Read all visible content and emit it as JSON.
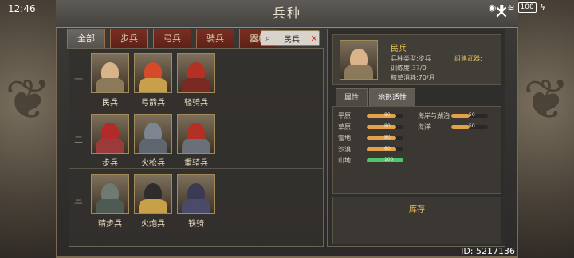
{
  "status_bar": {
    "time": "12:46",
    "battery": "100"
  },
  "window": {
    "title": "兵种",
    "close_icon": "close-x-icon"
  },
  "filter_tabs": [
    "全部",
    "步兵",
    "弓兵",
    "骑兵",
    "器械"
  ],
  "search": {
    "value": "民兵"
  },
  "units": [
    {
      "row": "一",
      "items": [
        {
          "name": "民兵",
          "helmet": "#c9c4b8",
          "armor": "#8a7a5a"
        },
        {
          "name": "弓箭兵",
          "helmet": "#d64a2a",
          "armor": "#c9a04a"
        },
        {
          "name": "轻骑兵",
          "helmet": "#b53024",
          "armor": "#7a2a22"
        }
      ]
    },
    {
      "row": "二",
      "items": [
        {
          "name": "步兵",
          "helmet": "#b22a2a",
          "armor": "#9a3a3a"
        },
        {
          "name": "火枪兵",
          "helmet": "#7c8590",
          "armor": "#5f6670"
        },
        {
          "name": "重骑兵",
          "helmet": "#b53024",
          "armor": "#6a6f78"
        }
      ]
    },
    {
      "row": "三",
      "items": [
        {
          "name": "精步兵",
          "helmet": "#6f7a72",
          "armor": "#4f5a52"
        },
        {
          "name": "火炮兵",
          "helmet": "#2f2d2b",
          "armor": "#c9a04a"
        },
        {
          "name": "铁骑",
          "helmet": "#3a3a55",
          "armor": "#4a4a6a"
        }
      ]
    }
  ],
  "detail": {
    "name": "民兵",
    "type_label": "兵种类型:",
    "type_value": "步兵",
    "train_label": "训练度:",
    "train_value": "37",
    "train_suffix": "/0",
    "food_label": "粮草消耗:",
    "food_value": "70/月",
    "craft_link": "组建武器:",
    "tabs": [
      "属性",
      "地形适性"
    ],
    "active_tab": 1,
    "terrain": [
      {
        "name": "平原",
        "value": "80",
        "ratio": 0.8,
        "color": "#e2a24a"
      },
      {
        "name": "海岸与湖泊",
        "value": "50",
        "ratio": 0.5,
        "color": "#e2a24a"
      },
      {
        "name": "草原",
        "value": "80",
        "ratio": 0.8,
        "color": "#e2a24a"
      },
      {
        "name": "海洋",
        "value": "50",
        "ratio": 0.5,
        "color": "#e2a24a"
      },
      {
        "name": "雪地",
        "value": "80",
        "ratio": 0.8,
        "color": "#e2a24a"
      },
      {
        "name": "沙漠",
        "value": "80",
        "ratio": 0.8,
        "color": "#e2a24a"
      },
      {
        "name": "山地",
        "value": "100",
        "ratio": 1.0,
        "color": "#4fc46a"
      }
    ],
    "stock_title": "库存"
  },
  "footer": {
    "id": "ID: 5217136"
  }
}
